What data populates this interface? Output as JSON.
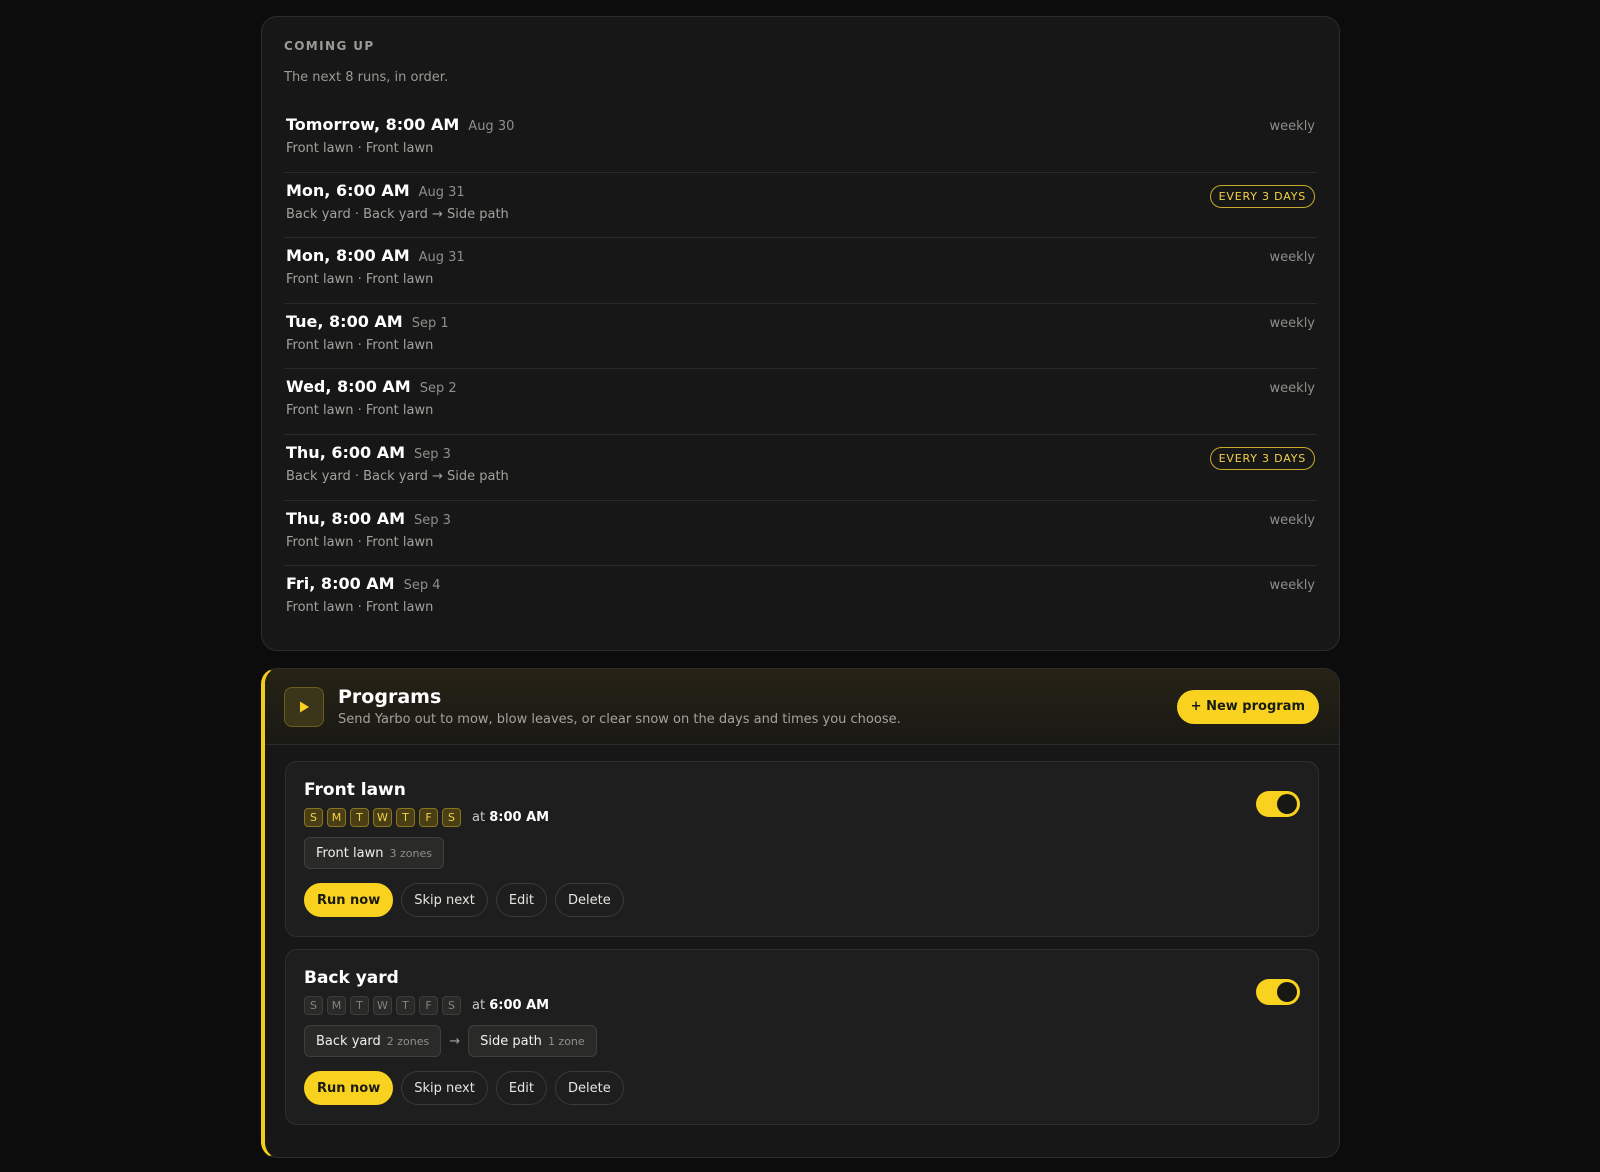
{
  "coming_up": {
    "title": "COMING UP",
    "subtitle": "The next 8 runs, in order.",
    "runs": [
      {
        "when": "Tomorrow, 8:00 AM",
        "date": "Aug 30",
        "desc": "Front lawn · Front lawn",
        "freq": "weekly",
        "badge": ""
      },
      {
        "when": "Mon, 6:00 AM",
        "date": "Aug 31",
        "desc": "Back yard · Back yard → Side path",
        "freq": "",
        "badge": "EVERY 3 DAYS"
      },
      {
        "when": "Mon, 8:00 AM",
        "date": "Aug 31",
        "desc": "Front lawn · Front lawn",
        "freq": "weekly",
        "badge": ""
      },
      {
        "when": "Tue, 8:00 AM",
        "date": "Sep 1",
        "desc": "Front lawn · Front lawn",
        "freq": "weekly",
        "badge": ""
      },
      {
        "when": "Wed, 8:00 AM",
        "date": "Sep 2",
        "desc": "Front lawn · Front lawn",
        "freq": "weekly",
        "badge": ""
      },
      {
        "when": "Thu, 6:00 AM",
        "date": "Sep 3",
        "desc": "Back yard · Back yard → Side path",
        "freq": "",
        "badge": "EVERY 3 DAYS"
      },
      {
        "when": "Thu, 8:00 AM",
        "date": "Sep 3",
        "desc": "Front lawn · Front lawn",
        "freq": "weekly",
        "badge": ""
      },
      {
        "when": "Fri, 8:00 AM",
        "date": "Sep 4",
        "desc": "Front lawn · Front lawn",
        "freq": "weekly",
        "badge": ""
      }
    ]
  },
  "programs": {
    "title": "Programs",
    "subtitle": "Send Yarbo out to mow, blow leaves, or clear snow on the days and times you choose.",
    "new_button": "+ New program",
    "icon": "play-icon",
    "accent_color": "#f8d21e",
    "items": [
      {
        "name": "Front lawn",
        "days": [
          {
            "label": "S",
            "on": true
          },
          {
            "label": "M",
            "on": true
          },
          {
            "label": "T",
            "on": true
          },
          {
            "label": "W",
            "on": true
          },
          {
            "label": "T",
            "on": true
          },
          {
            "label": "F",
            "on": true
          },
          {
            "label": "S",
            "on": true
          }
        ],
        "at": "at",
        "time": "8:00 AM",
        "zones": [
          {
            "name": "Front lawn",
            "count": "3 zones"
          }
        ],
        "enabled": true,
        "actions": {
          "run": "Run now",
          "skip": "Skip next",
          "edit": "Edit",
          "delete": "Delete"
        }
      },
      {
        "name": "Back yard",
        "days": [
          {
            "label": "S",
            "on": false
          },
          {
            "label": "M",
            "on": false
          },
          {
            "label": "T",
            "on": false
          },
          {
            "label": "W",
            "on": false
          },
          {
            "label": "T",
            "on": false
          },
          {
            "label": "F",
            "on": false
          },
          {
            "label": "S",
            "on": false
          }
        ],
        "at": "at",
        "time": "6:00 AM",
        "zones": [
          {
            "name": "Back yard",
            "count": "2 zones"
          },
          {
            "name": "Side path",
            "count": "1 zone"
          }
        ],
        "zone_separator": "→",
        "enabled": true,
        "actions": {
          "run": "Run now",
          "skip": "Skip next",
          "edit": "Edit",
          "delete": "Delete"
        }
      }
    ]
  }
}
